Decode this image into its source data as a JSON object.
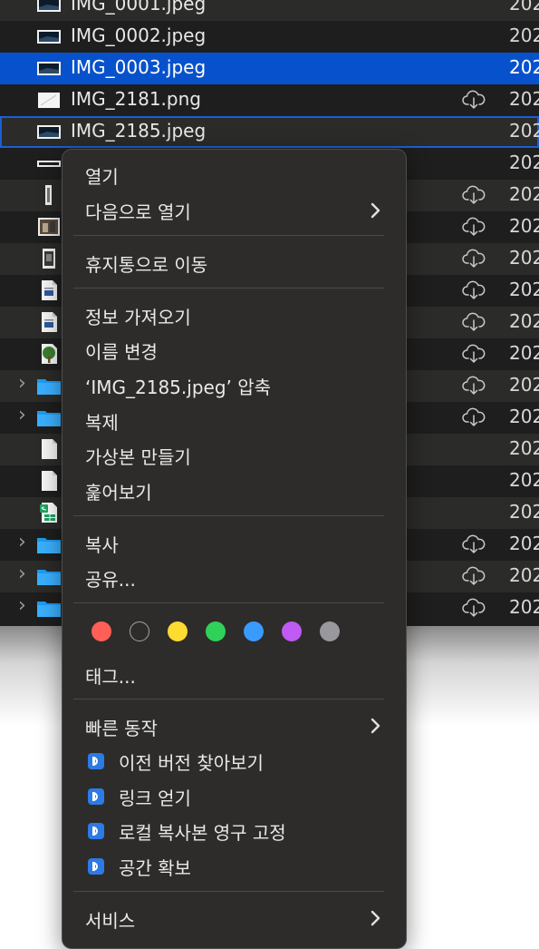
{
  "finder": {
    "rows": [
      {
        "name": "IMG_0001.jpeg",
        "date": "202",
        "icon": "image-thumbnail-icon",
        "cloud": false,
        "chevron": false
      },
      {
        "name": "IMG_0002.jpeg",
        "date": "202",
        "icon": "image-thumbnail-icon",
        "cloud": false,
        "chevron": false
      },
      {
        "name": "IMG_0003.jpeg",
        "date": "202",
        "icon": "image-thumbnail-icon",
        "cloud": false,
        "chevron": false,
        "selected": true
      },
      {
        "name": "IMG_2181.png",
        "date": "202",
        "icon": "png-thumbnail-icon",
        "cloud": true,
        "chevron": false
      },
      {
        "name": "IMG_2185.jpeg",
        "date": "202",
        "icon": "image-thumbnail-icon",
        "cloud": false,
        "chevron": false,
        "focused": true
      },
      {
        "name": "",
        "date": "202",
        "icon": "wide-thumbnail-icon",
        "cloud": false,
        "chevron": false
      },
      {
        "name": "",
        "date": "202",
        "icon": "tall-thumbnail-icon",
        "cloud": true,
        "chevron": false
      },
      {
        "name": "",
        "date": "202",
        "icon": "photo-thumbnail-icon",
        "cloud": true,
        "chevron": false
      },
      {
        "name": "",
        "date": "202",
        "icon": "phone-thumbnail-icon",
        "cloud": true,
        "chevron": false
      },
      {
        "name": "",
        "date": "202",
        "icon": "document-icon",
        "cloud": true,
        "chevron": false
      },
      {
        "name": "",
        "date": "202",
        "icon": "document-icon",
        "cloud": true,
        "chevron": false
      },
      {
        "name": "",
        "date": "202",
        "icon": "tree-image-icon",
        "cloud": true,
        "chevron": false
      },
      {
        "name": "",
        "date": "202",
        "icon": "folder-icon",
        "cloud": true,
        "chevron": true
      },
      {
        "name": "",
        "date": "202",
        "icon": "folder-icon",
        "cloud": true,
        "chevron": true
      },
      {
        "name": "",
        "date": "202",
        "icon": "blank-document-icon",
        "cloud": false,
        "chevron": false
      },
      {
        "name": "",
        "date": "202",
        "icon": "blank-document-icon",
        "cloud": false,
        "chevron": false
      },
      {
        "name": "",
        "date": "202",
        "icon": "spreadsheet-icon",
        "cloud": false,
        "chevron": false
      },
      {
        "name": "",
        "date": "202",
        "icon": "folder-icon",
        "cloud": true,
        "chevron": true
      },
      {
        "name": "",
        "date": "202",
        "icon": "folder-icon",
        "cloud": true,
        "chevron": true
      },
      {
        "name": "",
        "date": "202",
        "icon": "folder-icon",
        "cloud": true,
        "chevron": true
      }
    ]
  },
  "menu": {
    "open": "열기",
    "open_with": "다음으로 열기",
    "move_to_trash": "휴지통으로 이동",
    "get_info": "정보 가져오기",
    "rename": "이름 변경",
    "compress": "‘IMG_2185.jpeg’ 압축",
    "duplicate": "복제",
    "make_alias": "가상본 만들기",
    "quick_look": "훑어보기",
    "copy": "복사",
    "share": "공유...",
    "tag_colors": [
      "#ff5f57",
      "transparent",
      "#fedb30",
      "#30d158",
      "#3a9bff",
      "#bf5af2",
      "#98989d"
    ],
    "tags": "태그...",
    "quick_actions": "빠른 동작",
    "dropbox_items": [
      "이전 버전 찾아보기",
      "링크 얻기",
      "로컬 복사본 영구 고정",
      "공간 확보"
    ],
    "services": "서비스"
  }
}
